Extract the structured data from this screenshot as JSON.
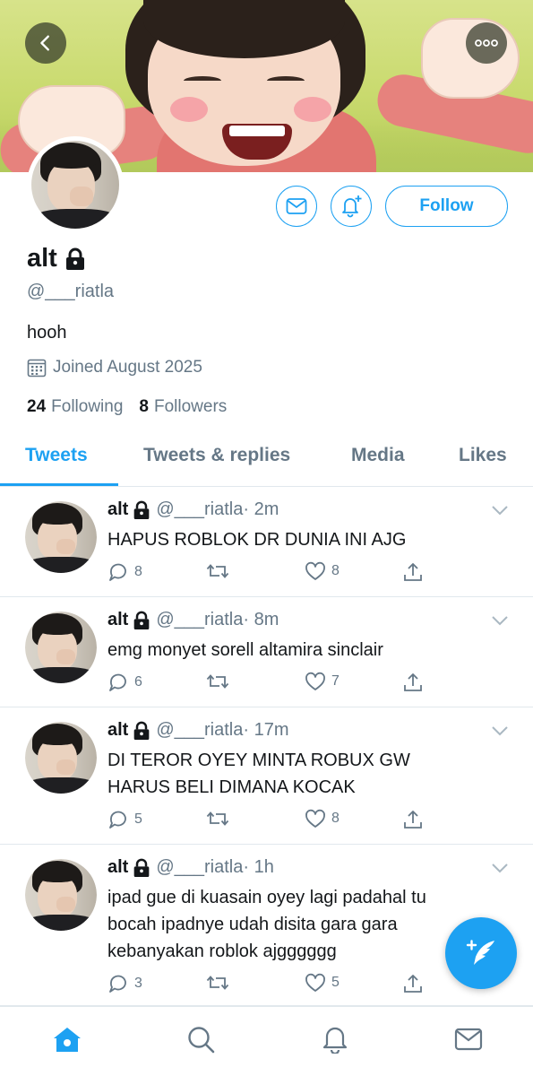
{
  "header": {
    "back_icon": "chevron-left-icon",
    "more_icon": "ellipsis-icon"
  },
  "profile": {
    "display_name": "alt",
    "locked_icon": "lock-icon",
    "handle": "@___riatla",
    "bio": "hooh",
    "joined": "Joined August 2025",
    "following_count": "24",
    "following_label": "Following",
    "followers_count": "8",
    "followers_label": "Followers",
    "follow_label": "Follow"
  },
  "tabs": [
    {
      "label": "Tweets",
      "active": true
    },
    {
      "label": "Tweets & replies",
      "active": false
    },
    {
      "label": "Media",
      "active": false
    },
    {
      "label": "Likes",
      "active": false
    }
  ],
  "tweets": [
    {
      "name": "alt",
      "handle": "@___riatla",
      "time": "· 2m",
      "text": "HAPUS ROBLOK DR DUNIA INI AJG",
      "replies": "8",
      "retweets": "",
      "likes": "8"
    },
    {
      "name": "alt",
      "handle": "@___riatla",
      "time": "· 8m",
      "text": "emg monyet sorell altamira sinclair",
      "replies": "6",
      "retweets": "",
      "likes": "7"
    },
    {
      "name": "alt",
      "handle": "@___riatla",
      "time": "· 17m",
      "text": "DI TEROR OYEY MINTA ROBUX GW HARUS BELI DIMANA KOCAK",
      "replies": "5",
      "retweets": "",
      "likes": "8"
    },
    {
      "name": "alt",
      "handle": "@___riatla",
      "time": "· 1h",
      "text": "ipad gue di kuasain oyey lagi padahal tu bocah ipadnye udah disita gara gara kebanyakan roblok ajgggggg",
      "replies": "3",
      "retweets": "",
      "likes": "5"
    }
  ],
  "colors": {
    "accent": "#1da1f2",
    "text": "#14171a",
    "muted": "#657786",
    "divider": "#e1e8ed"
  },
  "bottom_nav": [
    "home-icon",
    "search-icon",
    "bell-icon",
    "mail-icon"
  ]
}
